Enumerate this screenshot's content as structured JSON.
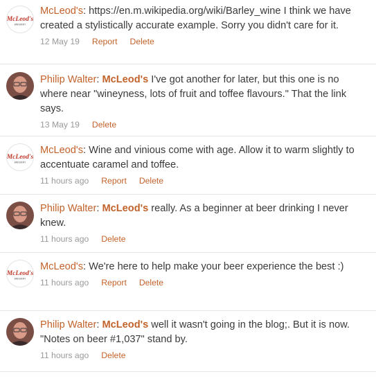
{
  "comments": [
    {
      "author": "McLeod's",
      "avatar": "mcleods-logo",
      "mention": "",
      "text": "https://en.m.wikipedia.org/wiki/Barley_wine I think we have created a stylistically accurate example. Sorry you didn't care for it.",
      "time": "12 May 19",
      "report_label": "Report",
      "delete_label": "Delete"
    },
    {
      "author": "Philip Walter",
      "avatar": "user-photo",
      "mention": "McLeod's",
      "text": " I've got another for later, but this one is no where near \"wineyness, lots of fruit and toffee flavours.\" That the link says.",
      "time": "13 May 19",
      "report_label": "",
      "delete_label": "Delete"
    },
    {
      "author": "McLeod's",
      "avatar": "mcleods-logo",
      "mention": "",
      "text": "Wine and vinious come with age. Allow it to warm slightly to accentuate caramel and toffee.",
      "time": "11 hours ago",
      "report_label": "Report",
      "delete_label": "Delete"
    },
    {
      "author": "Philip Walter",
      "avatar": "user-photo",
      "mention": "McLeod's",
      "text": " really. As a beginner at beer drinking I never knew.",
      "time": "11 hours ago",
      "report_label": "",
      "delete_label": "Delete"
    },
    {
      "author": "McLeod's",
      "avatar": "mcleods-logo",
      "mention": "",
      "text": "We're here to help make your beer experience the best :)",
      "time": "11 hours ago",
      "report_label": "Report",
      "delete_label": "Delete"
    },
    {
      "author": "Philip Walter",
      "avatar": "user-photo",
      "mention": "McLeod's",
      "text": " well it wasn't going in the blog;. But it is now. \"Notes on beer #1,037\" stand by.",
      "time": "11 hours ago",
      "report_label": "",
      "delete_label": "Delete"
    }
  ],
  "colors": {
    "accent": "#c2622a",
    "text": "#3a3a3a",
    "meta": "#9a9a9a",
    "divider": "#e6e6e6"
  }
}
